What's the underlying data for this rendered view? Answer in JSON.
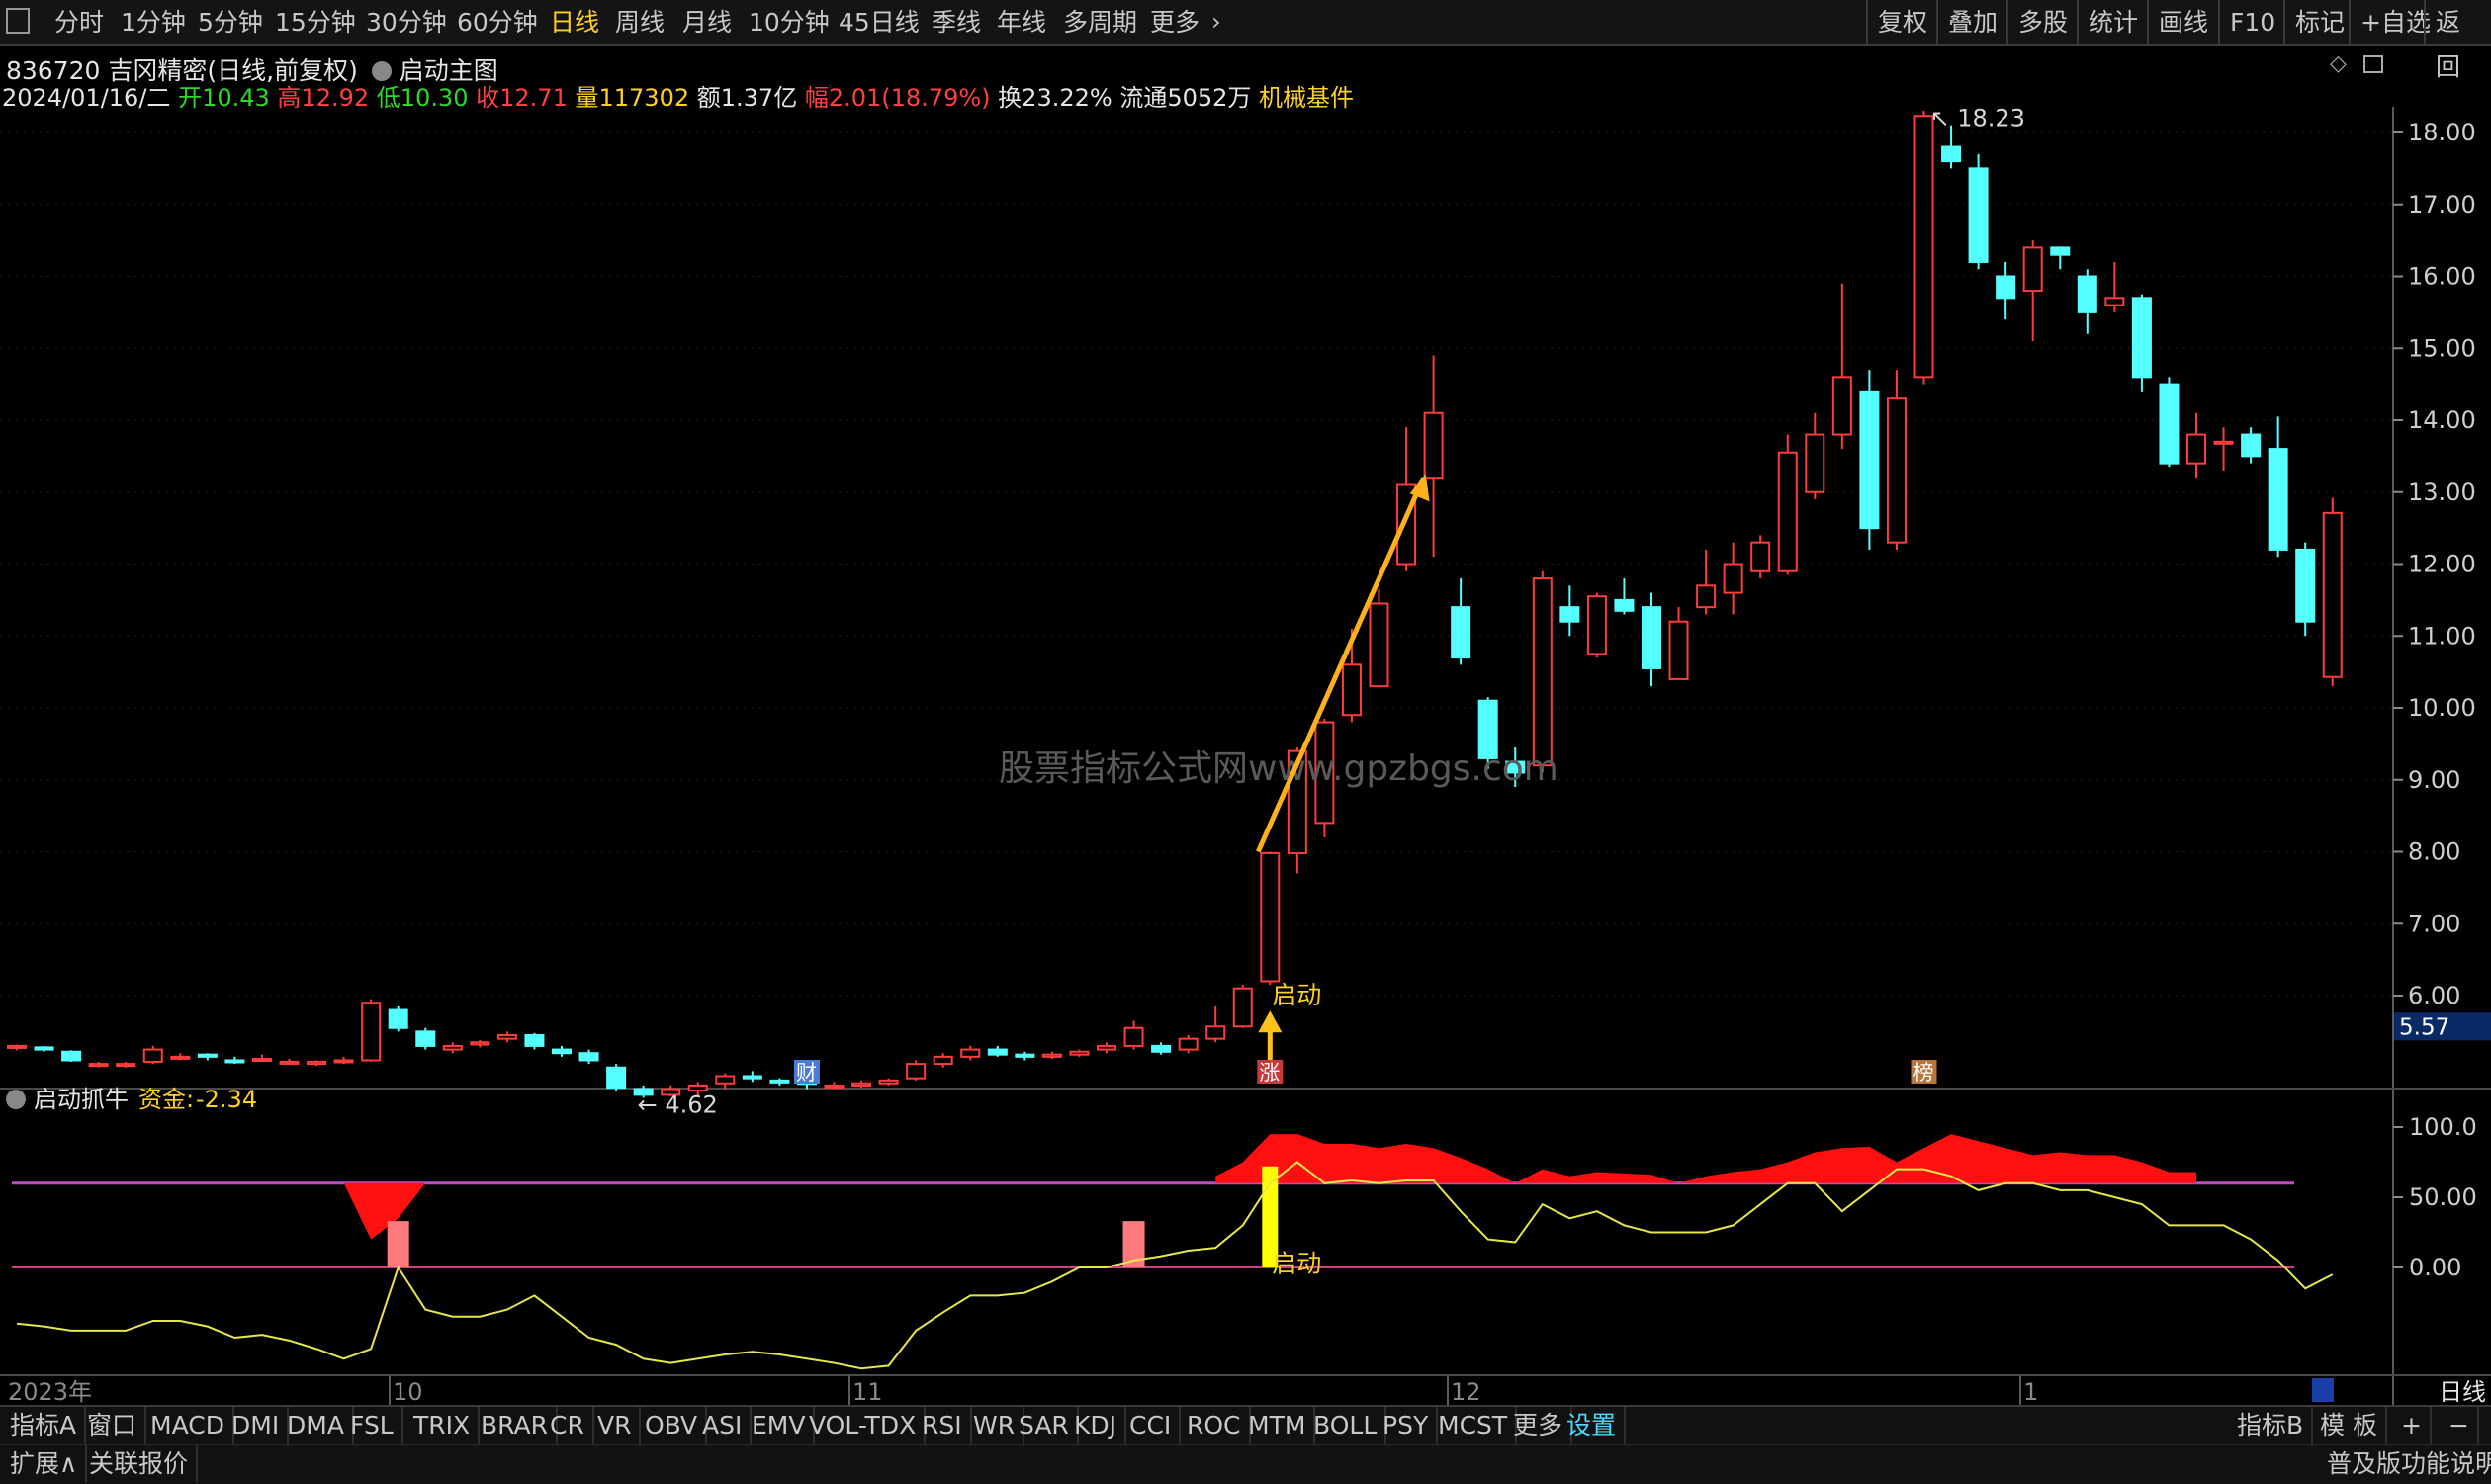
{
  "toolbar": {
    "periods": [
      "分时",
      "1分钟",
      "5分钟",
      "15分钟",
      "30分钟",
      "60分钟",
      "日线",
      "周线",
      "月线",
      "10分钟",
      "45日线",
      "季线",
      "年线",
      "多周期",
      "更多"
    ],
    "active_period": "日线",
    "right": [
      "复权",
      "叠加",
      "多股",
      "统计",
      "画线",
      "F10",
      "标记",
      "+自选",
      "返回"
    ]
  },
  "stock": {
    "code": "836720",
    "name": "吉冈精密",
    "mode": "(日线,前复权)",
    "template": "启动主图",
    "date": "2024/01/16/二",
    "open_label": "开",
    "open": "10.43",
    "high_label": "高",
    "high": "12.92",
    "low_label": "低",
    "low": "10.30",
    "close_label": "收",
    "close": "12.71",
    "vol_label": "量",
    "vol": "117302",
    "amount_label": "额",
    "amount": "1.37亿",
    "range_label": "幅",
    "range": "2.01(18.79%)",
    "turnover_label": "换",
    "turnover": "23.22%",
    "float_label": "流通",
    "float": "5052万",
    "sector": "机械基件"
  },
  "watermark": "股票指标公式网www.gpzbgs.com",
  "main_chart": {
    "price_ticks": [
      "18.00",
      "17.00",
      "16.00",
      "15.00",
      "14.00",
      "13.00",
      "12.00",
      "11.00",
      "10.00",
      "9.00",
      "8.00",
      "7.00",
      "6.00"
    ],
    "current_price": "5.57",
    "high_mark": "18.23",
    "low_mark": "4.62",
    "start_label": "启动",
    "event_tags": [
      {
        "text": "财",
        "color": "#4a7bd6"
      },
      {
        "text": "涨",
        "color": "#c83a3a"
      },
      {
        "text": "榜",
        "color": "#b8763a"
      }
    ]
  },
  "chart_data": {
    "type": "candlestick",
    "ylim": [
      4.3,
      18.6
    ],
    "candles": [
      [
        5.28,
        5.3,
        5.24,
        5.32
      ],
      [
        5.28,
        5.25,
        5.22,
        5.3
      ],
      [
        5.22,
        5.1,
        5.08,
        5.24
      ],
      [
        5.05,
        5.05,
        5.0,
        5.08
      ],
      [
        5.05,
        5.05,
        5.0,
        5.08
      ],
      [
        5.08,
        5.25,
        5.05,
        5.3
      ],
      [
        5.15,
        5.15,
        5.1,
        5.2
      ],
      [
        5.18,
        5.15,
        5.1,
        5.2
      ],
      [
        5.1,
        5.08,
        5.05,
        5.15
      ],
      [
        5.12,
        5.12,
        5.08,
        5.18
      ],
      [
        5.08,
        5.08,
        5.05,
        5.12
      ],
      [
        5.05,
        5.08,
        5.02,
        5.1
      ],
      [
        5.1,
        5.1,
        5.05,
        5.15
      ],
      [
        5.1,
        5.9,
        5.08,
        5.95
      ],
      [
        5.8,
        5.55,
        5.5,
        5.85
      ],
      [
        5.5,
        5.3,
        5.25,
        5.55
      ],
      [
        5.25,
        5.3,
        5.2,
        5.35
      ],
      [
        5.32,
        5.35,
        5.28,
        5.38
      ],
      [
        5.4,
        5.45,
        5.35,
        5.5
      ],
      [
        5.45,
        5.3,
        5.25,
        5.48
      ],
      [
        5.25,
        5.2,
        5.15,
        5.3
      ],
      [
        5.2,
        5.1,
        5.05,
        5.25
      ],
      [
        5.0,
        4.72,
        4.68,
        5.05
      ],
      [
        4.7,
        4.62,
        4.58,
        4.75
      ],
      [
        4.62,
        4.7,
        4.6,
        4.75
      ],
      [
        4.68,
        4.75,
        4.6,
        4.8
      ],
      [
        4.78,
        4.88,
        4.7,
        4.92
      ],
      [
        4.88,
        4.85,
        4.8,
        4.95
      ],
      [
        4.82,
        4.8,
        4.75,
        4.85
      ],
      [
        4.8,
        4.78,
        4.7,
        4.82
      ],
      [
        4.75,
        4.75,
        4.7,
        4.8
      ],
      [
        4.75,
        4.78,
        4.72,
        4.82
      ],
      [
        4.78,
        4.82,
        4.75,
        4.85
      ],
      [
        4.85,
        5.05,
        4.82,
        5.1
      ],
      [
        5.05,
        5.15,
        5.0,
        5.2
      ],
      [
        5.15,
        5.25,
        5.1,
        5.3
      ],
      [
        5.25,
        5.18,
        5.15,
        5.3
      ],
      [
        5.18,
        5.15,
        5.1,
        5.22
      ],
      [
        5.15,
        5.18,
        5.12,
        5.22
      ],
      [
        5.18,
        5.22,
        5.15,
        5.25
      ],
      [
        5.25,
        5.3,
        5.2,
        5.35
      ],
      [
        5.3,
        5.55,
        5.25,
        5.65
      ],
      [
        5.3,
        5.22,
        5.18,
        5.35
      ],
      [
        5.25,
        5.4,
        5.2,
        5.45
      ],
      [
        5.4,
        5.57,
        5.35,
        5.85
      ],
      [
        5.57,
        6.1,
        5.55,
        6.15
      ],
      [
        6.2,
        7.98,
        6.15,
        8.0
      ],
      [
        7.98,
        9.4,
        7.7,
        9.45
      ],
      [
        8.4,
        9.8,
        8.2,
        9.85
      ],
      [
        9.9,
        10.6,
        9.8,
        11.1
      ],
      [
        10.3,
        11.45,
        10.3,
        11.65
      ],
      [
        12.0,
        13.1,
        11.9,
        13.9
      ],
      [
        13.2,
        14.1,
        12.1,
        14.9
      ],
      [
        11.4,
        10.7,
        10.6,
        11.8
      ],
      [
        10.1,
        9.3,
        9.15,
        10.15
      ],
      [
        9.25,
        9.1,
        8.9,
        9.45
      ],
      [
        9.2,
        11.8,
        9.1,
        11.9
      ],
      [
        11.4,
        11.2,
        11.0,
        11.7
      ],
      [
        10.75,
        11.55,
        10.7,
        11.6
      ],
      [
        11.5,
        11.35,
        11.3,
        11.8
      ],
      [
        11.4,
        10.55,
        10.3,
        11.6
      ],
      [
        10.4,
        11.2,
        10.4,
        11.4
      ],
      [
        11.4,
        11.7,
        11.3,
        12.2
      ],
      [
        11.6,
        12.0,
        11.3,
        12.3
      ],
      [
        11.9,
        12.3,
        11.8,
        12.4
      ],
      [
        11.9,
        13.55,
        11.85,
        13.8
      ],
      [
        13.0,
        13.8,
        12.9,
        14.1
      ],
      [
        13.8,
        14.6,
        13.6,
        15.9
      ],
      [
        14.4,
        12.5,
        12.2,
        14.7
      ],
      [
        12.3,
        14.3,
        12.2,
        14.7
      ],
      [
        14.6,
        18.23,
        14.5,
        18.3
      ],
      [
        17.8,
        17.6,
        17.5,
        18.1
      ],
      [
        17.5,
        16.2,
        16.1,
        17.7
      ],
      [
        16.0,
        15.7,
        15.4,
        16.2
      ],
      [
        15.8,
        16.4,
        15.1,
        16.5
      ],
      [
        16.4,
        16.3,
        16.1,
        16.4
      ],
      [
        16.0,
        15.5,
        15.2,
        16.1
      ],
      [
        15.6,
        15.7,
        15.5,
        16.2
      ],
      [
        15.7,
        14.6,
        14.4,
        15.75
      ],
      [
        14.5,
        13.4,
        13.35,
        14.6
      ],
      [
        13.4,
        13.8,
        13.2,
        14.1
      ],
      [
        13.7,
        13.7,
        13.3,
        13.9
      ],
      [
        13.8,
        13.5,
        13.4,
        13.9
      ],
      [
        13.6,
        12.2,
        12.1,
        14.05
      ],
      [
        12.2,
        11.2,
        11.0,
        12.3
      ],
      [
        10.43,
        12.71,
        10.3,
        12.92
      ]
    ],
    "x_labels": [
      "2023年",
      "10",
      "11",
      "12",
      "1"
    ]
  },
  "indicator": {
    "name": "启动抓牛",
    "fund_label": "资金:",
    "fund_value": "-2.34",
    "y_ticks": [
      "100.0",
      "50.00",
      "0.00"
    ],
    "start_label": "启动"
  },
  "indicator_data": {
    "line": [
      -40,
      -42,
      -45,
      -45,
      -45,
      -38,
      -38,
      -42,
      -50,
      -48,
      -52,
      -58,
      -65,
      -58,
      0,
      -30,
      -35,
      -35,
      -30,
      -20,
      -35,
      -50,
      -55,
      -65,
      -68,
      -65,
      -62,
      -60,
      -62,
      -65,
      -68,
      -72,
      -70,
      -45,
      -32,
      -20,
      -20,
      -18,
      -10,
      0,
      0,
      5,
      8,
      12,
      14,
      30,
      60,
      75,
      60,
      62,
      60,
      62,
      62,
      40,
      20,
      18,
      45,
      35,
      40,
      30,
      25,
      25,
      25,
      30,
      45,
      60,
      60,
      40,
      55,
      70,
      70,
      65,
      55,
      60,
      60,
      55,
      55,
      50,
      45,
      30,
      30,
      30,
      20,
      5,
      -15,
      -5
    ],
    "red_area_ranges": [
      [
        13,
        14
      ],
      [
        44,
        80
      ]
    ],
    "pink_bars": [
      14,
      41
    ],
    "yellow_bar": 46
  },
  "bottom_tabs": [
    "指标A",
    "窗口",
    "MACD",
    "DMI",
    "DMA",
    "FSL",
    "TRIX",
    "BRAR",
    "CR",
    "VR",
    "OBV",
    "ASI",
    "EMV",
    "VOL-TDX",
    "RSI",
    "WR",
    "SAR",
    "KDJ",
    "CCI",
    "ROC",
    "MTM",
    "BOLL",
    "PSY",
    "MCST",
    "更多",
    "设置"
  ],
  "bottom_right": [
    "指标B",
    "模 板",
    "+",
    "−"
  ],
  "bottom_left2": [
    "扩展∧",
    "关联报价"
  ],
  "bottom_right2": "普及版功能说明",
  "period_label": "日线"
}
